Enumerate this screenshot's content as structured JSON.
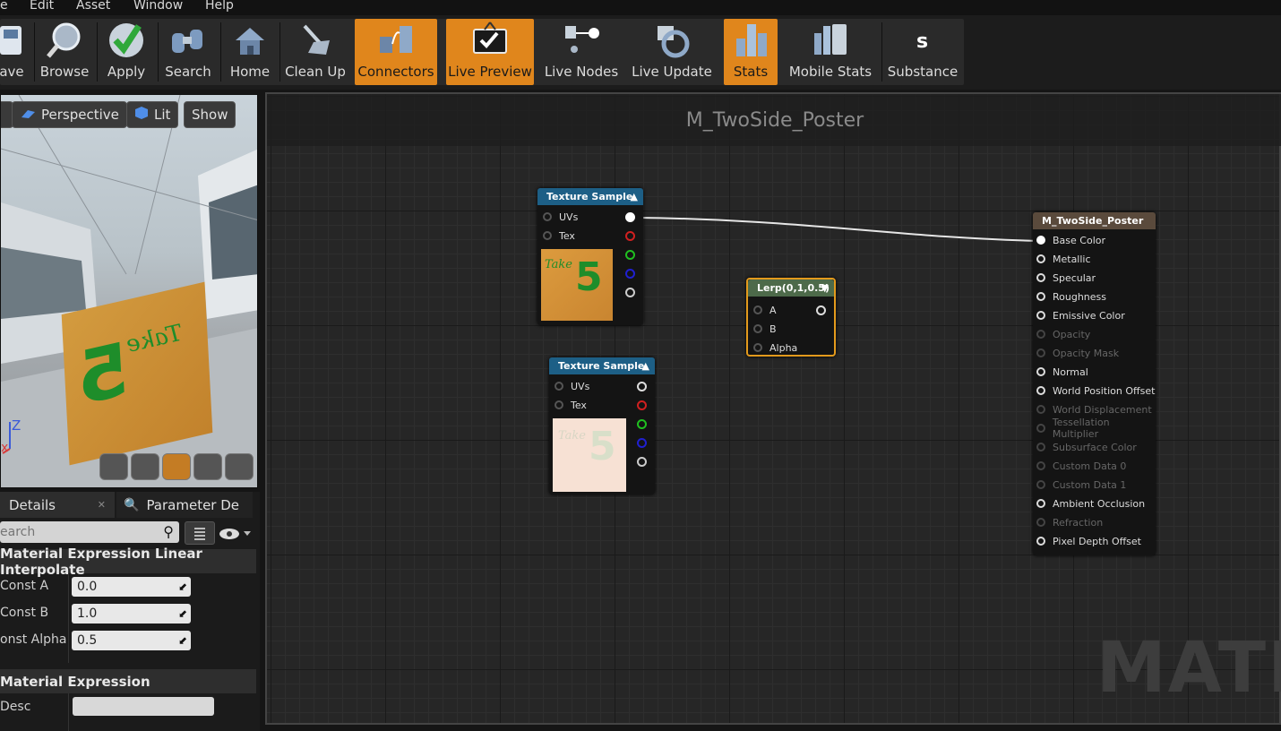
{
  "menu": [
    "e",
    "Edit",
    "Asset",
    "Window",
    "Help"
  ],
  "toolbar": [
    {
      "label": "ave",
      "icon": "save-icon"
    },
    {
      "label": "Browse",
      "icon": "browse-icon"
    },
    {
      "label": "Apply",
      "icon": "apply-checkmark-icon"
    },
    {
      "label": "Search",
      "icon": "search-binoculars-icon"
    },
    {
      "label": "Home",
      "icon": "home-icon"
    },
    {
      "label": "Clean Up",
      "icon": "clean-up-broom-icon"
    },
    {
      "label": "Connectors",
      "icon": "connectors-icon",
      "active": true
    },
    {
      "label": "Live Preview",
      "icon": "live-preview-tv-icon",
      "active": true
    },
    {
      "label": "Live Nodes",
      "icon": "live-nodes-icon"
    },
    {
      "label": "Live Update",
      "icon": "live-update-icon"
    },
    {
      "label": "Stats",
      "icon": "stats-icon",
      "active": true
    },
    {
      "label": "Mobile Stats",
      "icon": "mobile-stats-icon"
    },
    {
      "label": "Substance",
      "icon": "substance-icon"
    }
  ],
  "viewport": {
    "perspective": "Perspective",
    "lit": "Lit",
    "show": "Show",
    "axis_z": "Z",
    "axis_x": "x",
    "poster_take": "Take",
    "poster_five": "5"
  },
  "details": {
    "tab_details": "Details",
    "tab_param": "Parameter De",
    "search_placeholder": "earch",
    "cat1": "Material Expression Linear Interpolate",
    "props": [
      {
        "label": "Const A",
        "value": "0.0"
      },
      {
        "label": "Const B",
        "value": "1.0"
      },
      {
        "label": "onst Alpha",
        "value": "0.5"
      }
    ],
    "cat2": "Material Expression",
    "desc_label": "Desc",
    "desc_value": ""
  },
  "graph": {
    "title": "M_TwoSide_Poster",
    "watermark": "MATER",
    "tex1": {
      "title": "Texture Sample",
      "uvs": "UVs",
      "tex": "Tex",
      "thumb_take": "Take",
      "thumb_five": "5"
    },
    "tex2": {
      "title": "Texture Sample",
      "uvs": "UVs",
      "tex": "Tex",
      "thumb_take": "Take",
      "thumb_five": "5"
    },
    "lerp": {
      "title": "Lerp(0,1,0.5)",
      "a": "A",
      "b": "B",
      "alpha": "Alpha"
    },
    "material": {
      "title": "M_TwoSide_Poster",
      "inputs": [
        {
          "label": "Base Color",
          "enabled": true
        },
        {
          "label": "Metallic",
          "enabled": true
        },
        {
          "label": "Specular",
          "enabled": true
        },
        {
          "label": "Roughness",
          "enabled": true
        },
        {
          "label": "Emissive Color",
          "enabled": true
        },
        {
          "label": "Opacity",
          "enabled": false
        },
        {
          "label": "Opacity Mask",
          "enabled": false
        },
        {
          "label": "Normal",
          "enabled": true
        },
        {
          "label": "World Position Offset",
          "enabled": true
        },
        {
          "label": "World Displacement",
          "enabled": false
        },
        {
          "label": "Tessellation Multiplier",
          "enabled": false
        },
        {
          "label": "Subsurface Color",
          "enabled": false
        },
        {
          "label": "Custom Data 0",
          "enabled": false
        },
        {
          "label": "Custom Data 1",
          "enabled": false
        },
        {
          "label": "Ambient Occlusion",
          "enabled": true
        },
        {
          "label": "Refraction",
          "enabled": false
        },
        {
          "label": "Pixel Depth Offset",
          "enabled": true
        }
      ]
    }
  },
  "colors": {
    "accent": "#e0861c",
    "texture_header": "#1d5f86",
    "lerp_header": "#4d6a4a",
    "material_header": "#5a4a3c"
  }
}
